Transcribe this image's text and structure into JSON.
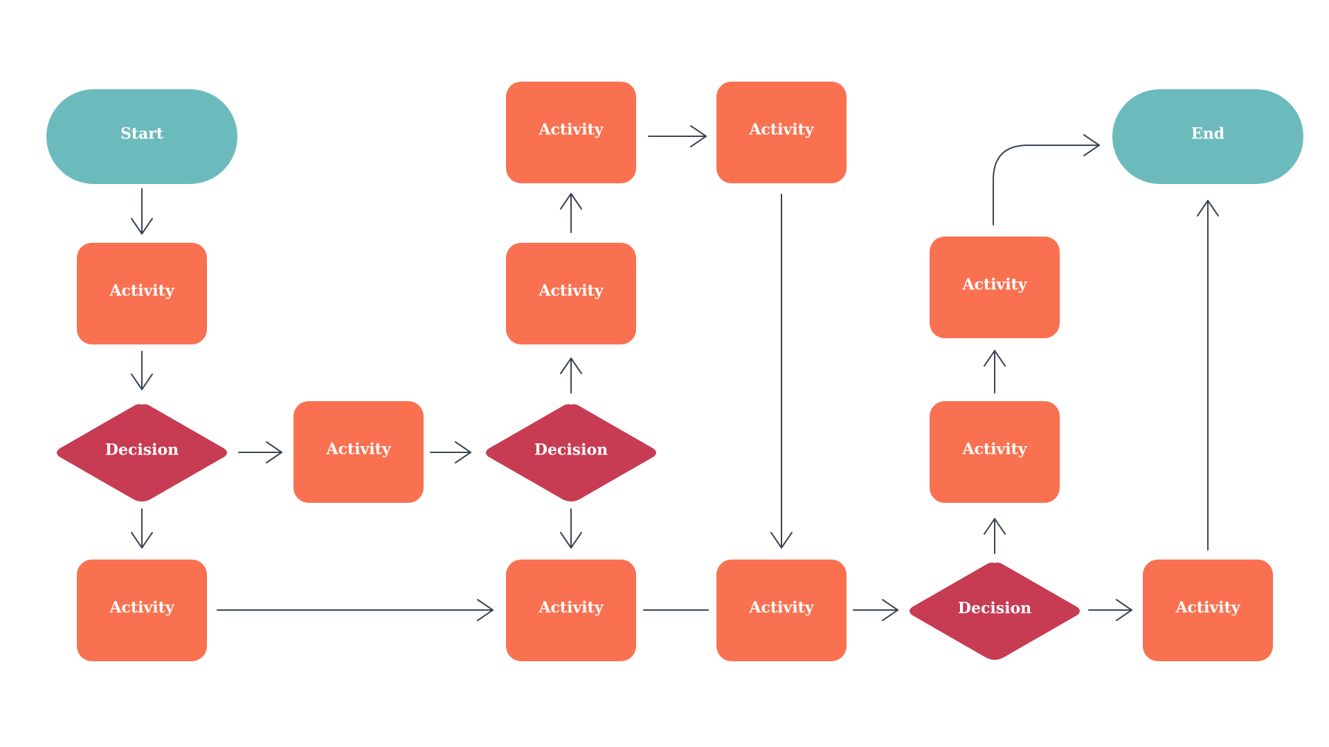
{
  "diagram": {
    "type": "flowchart",
    "colors": {
      "terminal": "#6cbbbc",
      "activity": "#f97150",
      "decision": "#c73c52",
      "connector": "#3a4350",
      "label": "#ffffff"
    },
    "nodes": [
      {
        "id": "start",
        "kind": "terminal",
        "label": "Start"
      },
      {
        "id": "act-a",
        "kind": "activity",
        "label": "Activity"
      },
      {
        "id": "dec-1",
        "kind": "decision",
        "label": "Decision"
      },
      {
        "id": "act-b",
        "kind": "activity",
        "label": "Activity"
      },
      {
        "id": "act-c",
        "kind": "activity",
        "label": "Activity"
      },
      {
        "id": "dec-2",
        "kind": "decision",
        "label": "Decision"
      },
      {
        "id": "act-d",
        "kind": "activity",
        "label": "Activity"
      },
      {
        "id": "act-e",
        "kind": "activity",
        "label": "Activity"
      },
      {
        "id": "act-f",
        "kind": "activity",
        "label": "Activity"
      },
      {
        "id": "act-g",
        "kind": "activity",
        "label": "Activity"
      },
      {
        "id": "act-h",
        "kind": "activity",
        "label": "Activity"
      },
      {
        "id": "dec-3",
        "kind": "decision",
        "label": "Decision"
      },
      {
        "id": "act-i",
        "kind": "activity",
        "label": "Activity"
      },
      {
        "id": "act-j",
        "kind": "activity",
        "label": "Activity"
      },
      {
        "id": "act-k",
        "kind": "activity",
        "label": "Activity"
      },
      {
        "id": "end",
        "kind": "terminal",
        "label": "End"
      }
    ],
    "edges": [
      {
        "from": "start",
        "to": "act-a",
        "arrow": true
      },
      {
        "from": "act-a",
        "to": "dec-1",
        "arrow": true
      },
      {
        "from": "dec-1",
        "to": "act-b",
        "arrow": true
      },
      {
        "from": "dec-1",
        "to": "act-c",
        "arrow": true
      },
      {
        "from": "act-c",
        "to": "dec-2",
        "arrow": true
      },
      {
        "from": "dec-2",
        "to": "act-d",
        "arrow": true
      },
      {
        "from": "act-d",
        "to": "act-e",
        "arrow": true
      },
      {
        "from": "act-e",
        "to": "act-f",
        "arrow": true
      },
      {
        "from": "act-f",
        "to": "act-h",
        "arrow": true
      },
      {
        "from": "dec-2",
        "to": "act-g",
        "arrow": true
      },
      {
        "from": "act-b",
        "to": "act-g",
        "arrow": true
      },
      {
        "from": "act-g",
        "to": "act-h",
        "arrow": false
      },
      {
        "from": "act-h",
        "to": "dec-3",
        "arrow": true
      },
      {
        "from": "dec-3",
        "to": "act-k",
        "arrow": true
      },
      {
        "from": "dec-3",
        "to": "act-i",
        "arrow": true
      },
      {
        "from": "act-i",
        "to": "act-j",
        "arrow": true
      },
      {
        "from": "act-j",
        "to": "end",
        "arrow": true
      },
      {
        "from": "act-k",
        "to": "end",
        "arrow": true
      }
    ]
  }
}
